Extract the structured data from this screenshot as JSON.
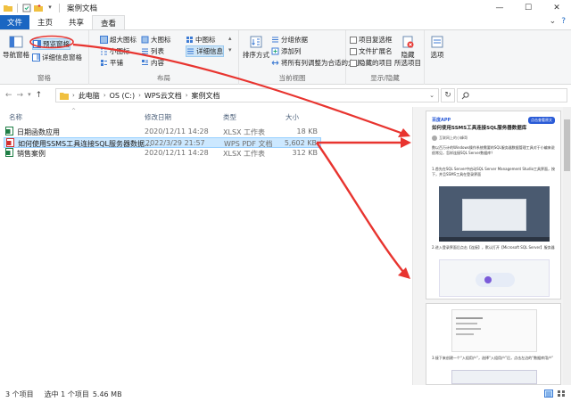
{
  "window": {
    "title": "案例文档",
    "controls": {
      "minimize": "—",
      "maximize": "☐",
      "close": "✕"
    }
  },
  "tabs": [
    {
      "label": "文件"
    },
    {
      "label": "主页"
    },
    {
      "label": "共享"
    },
    {
      "label": "查看"
    }
  ],
  "ribbon": {
    "panes": {
      "label": "窗格",
      "nav_pane": "导航窗格",
      "preview_pane": "预览窗格",
      "details_pane": "详细信息窗格"
    },
    "layout": {
      "label": "布局",
      "xl_icons": "超大图标",
      "large_icons": "大图标",
      "medium_icons": "中图标",
      "small_icons": "小图标",
      "list": "列表",
      "details": "详细信息",
      "tiles": "平铺",
      "content": "内容"
    },
    "current_view": {
      "label": "当前视图",
      "sort": "排序方式",
      "group_by": "分组依据",
      "add_column": "添加列",
      "fit_columns": "将所有列调整为合适的大小"
    },
    "show_hide": {
      "label": "显示/隐藏",
      "item_checkbox": "项目复选框",
      "file_ext": "文件扩展名",
      "hidden_items": "隐藏的项目",
      "hide_selected_1": "隐藏",
      "hide_selected_2": "所选项目"
    },
    "options": "选项"
  },
  "address": {
    "parts": [
      "此电脑",
      "OS (C:)",
      "WPS云文档",
      "案例文档"
    ],
    "search_icon": "search-icon"
  },
  "columns": {
    "name": "名称",
    "date": "修改日期",
    "type": "类型",
    "size": "大小"
  },
  "files": [
    {
      "name": "日期函数应用",
      "date": "2020/12/11 14:28",
      "type": "XLSX 工作表",
      "size": "18 KB",
      "icon": "xlsx"
    },
    {
      "name": "如何使用SSMS工具连接SQL服务器数据...",
      "date": "2022/3/29 21:57",
      "type": "WPS PDF 文档",
      "size": "5,602 KB",
      "icon": "pdf"
    },
    {
      "name": "销售案例",
      "date": "2020/12/11 14:28",
      "type": "XLSX 工作表",
      "size": "312 KB",
      "icon": "xlsx"
    }
  ],
  "preview": {
    "app_name": "百度APP",
    "doc_title": "如何使用SSMS工具连接SQL服务器数据库",
    "meta": "互联网上的小峰哥",
    "tag": "点击查看原文",
    "p1": "数以百万计的Windows操作系统需要的SQL服务器数据管理工具对于小编来说很常见，怎样连接SQL Server数据库？",
    "p2": "1.首先在SQL Server中启动SQL Server Management Studio工具界面，按下，并且SSMS工具在登录界面",
    "p3": "2.进入登录界面后点击【连接】，默认打开【Microsoft SQL Server】服务器",
    "p4": "3.接下来创建一个“入组用户”，选择“入组用户”后，点击左边的“数据库用户”"
  },
  "status": {
    "count": "3 个项目",
    "selected": "选中 1 个项目",
    "size": "5.46 MB"
  },
  "colors": {
    "accent": "#1a66c2",
    "selection": "#cce8ff",
    "annotation": "#e8342f"
  }
}
